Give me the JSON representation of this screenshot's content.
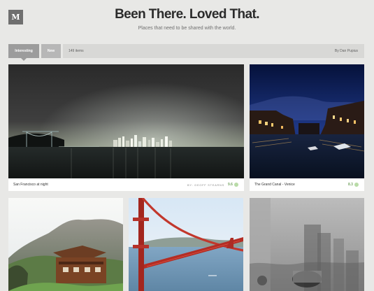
{
  "app": {
    "logo_text": "M"
  },
  "header": {
    "title": "Been There. Loved That.",
    "subtitle": "Places that need to be shared with the world."
  },
  "tabs": {
    "interesting_label": "Interesting",
    "new_label": "New",
    "items_count": "149 items",
    "author": "By Dan Pupius"
  },
  "cards": [
    {
      "title": "San Francisco at night",
      "credit": "BY: GEOFF STEARNS",
      "score": "9.6"
    },
    {
      "title": "The Grand Canal - Venice",
      "score": "8.3"
    }
  ],
  "colors": {
    "background": "#e8e8e6",
    "tab_active": "#9c9c9c",
    "tab_inactive": "#b7b7b7",
    "score_accent": "#7ba86a"
  },
  "icons": {
    "logo": "medium-logo-icon",
    "score": "score-dot-icon"
  }
}
